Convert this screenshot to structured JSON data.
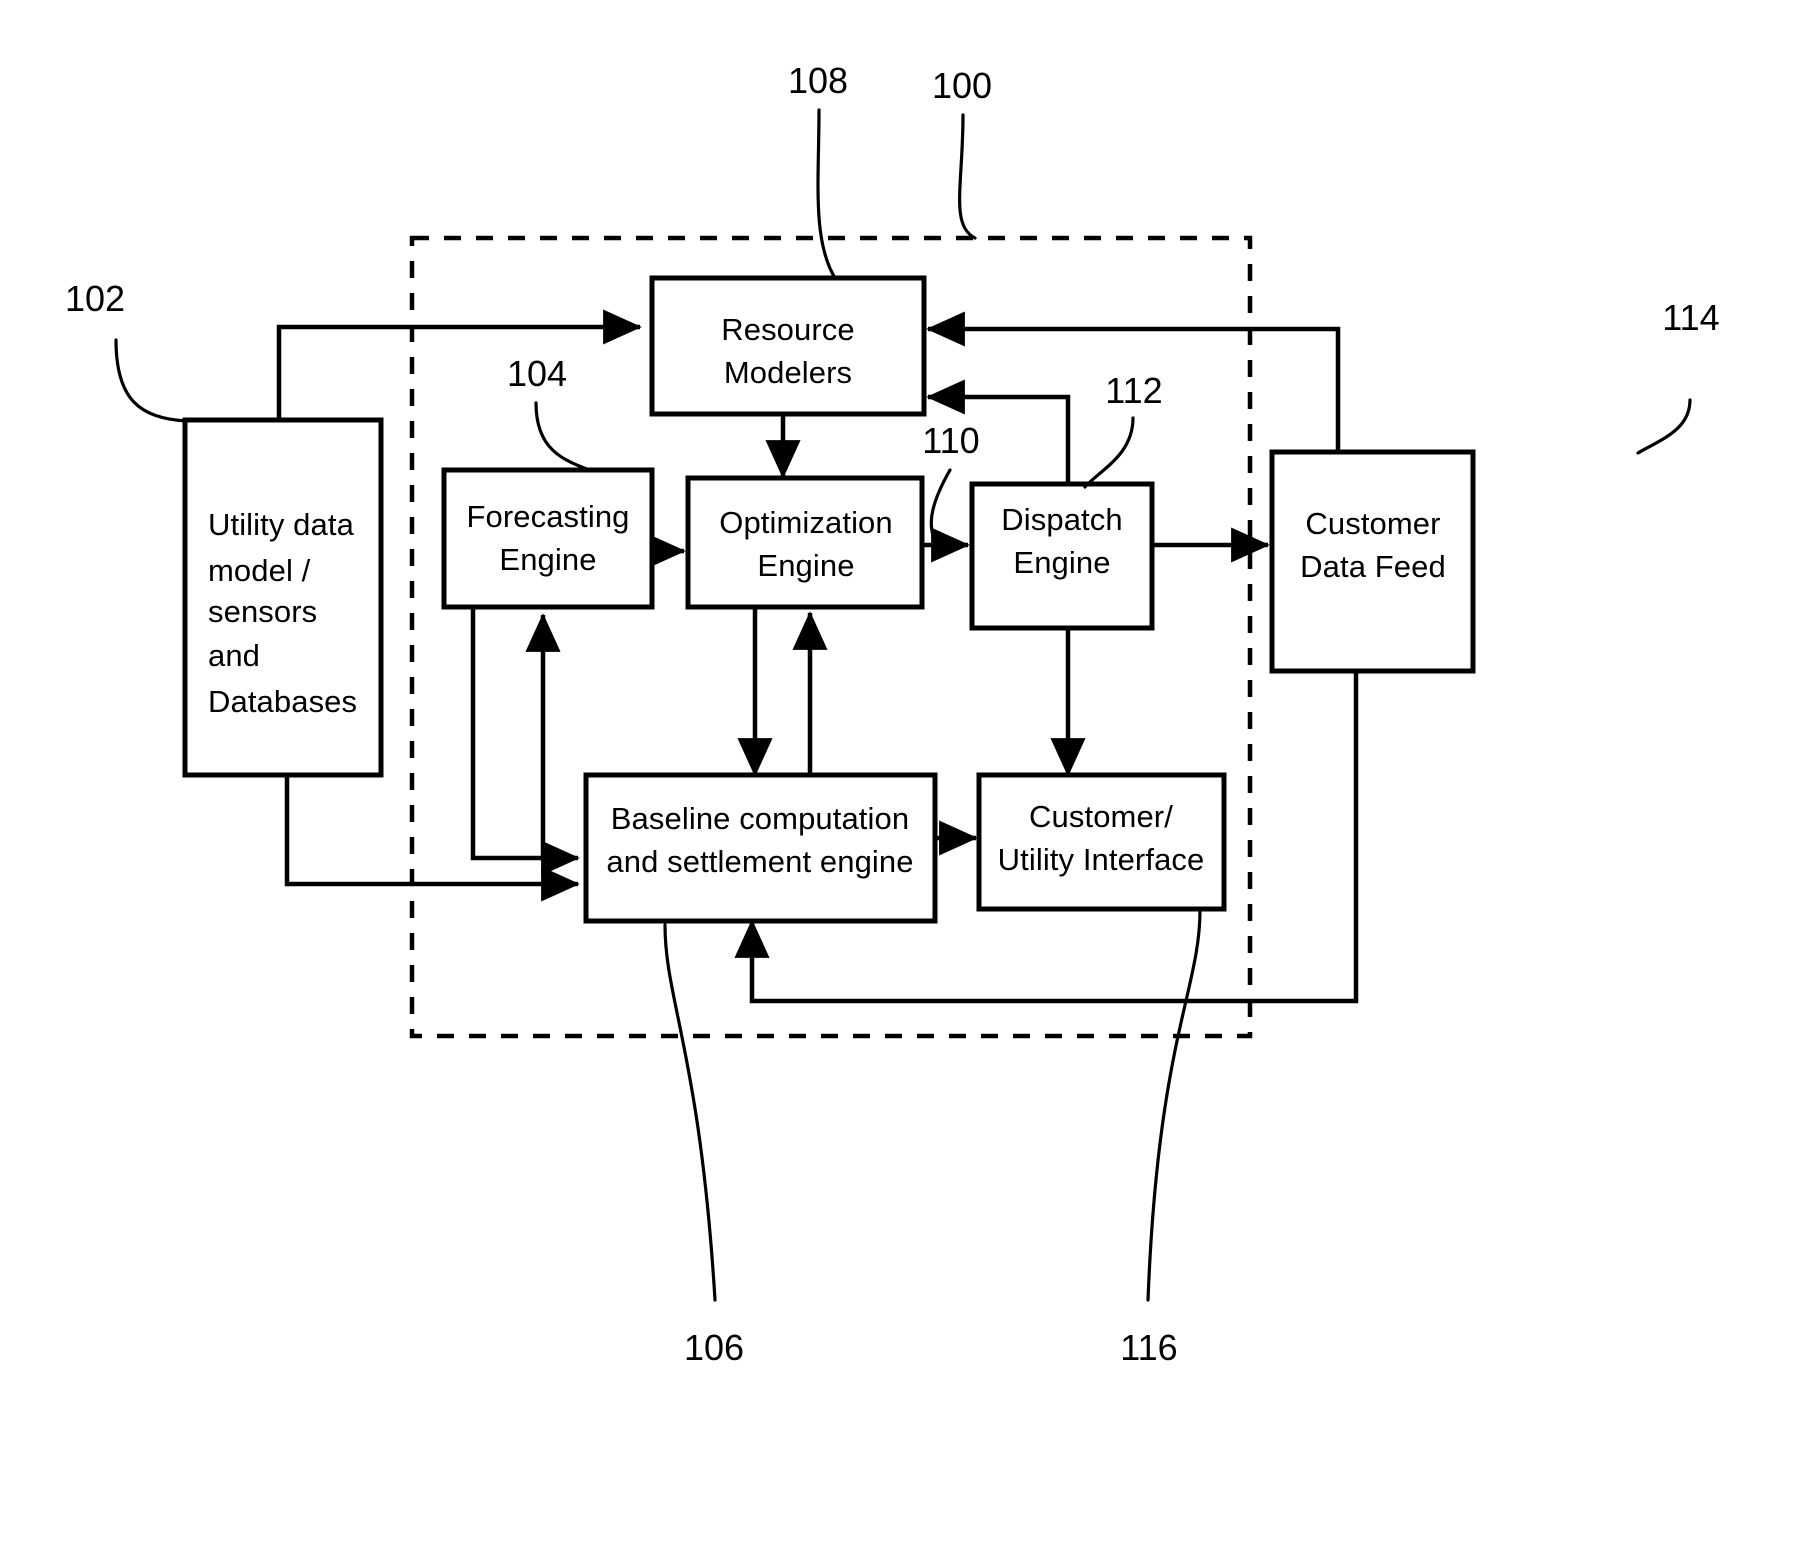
{
  "figure": {
    "type": "patent-block-diagram",
    "background_color": "#ffffff",
    "line_color": "#000000"
  },
  "boundary": {
    "label": "system-boundary",
    "style": "dashed",
    "ref": "100"
  },
  "boxes": [
    {
      "id": "utility-data-model",
      "ref": "102",
      "lines": [
        "Utility data",
        "model /",
        "sensors",
        "and",
        "Databases"
      ],
      "align": "left"
    },
    {
      "id": "resource-modelers",
      "ref": "108",
      "lines": [
        "Resource",
        "Modelers"
      ],
      "align": "center"
    },
    {
      "id": "forecasting-engine",
      "ref": "104",
      "lines": [
        "Forecasting",
        "Engine"
      ],
      "align": "center"
    },
    {
      "id": "optimization-engine",
      "ref": "110",
      "lines": [
        "Optimization",
        "Engine"
      ],
      "align": "center"
    },
    {
      "id": "dispatch-engine",
      "ref": "112",
      "lines": [
        "Dispatch",
        "Engine"
      ],
      "align": "center"
    },
    {
      "id": "customer-data-feed",
      "ref": "114",
      "lines": [
        "Customer",
        "Data Feed"
      ],
      "align": "center"
    },
    {
      "id": "baseline-settlement-engine",
      "ref": "106",
      "lines": [
        "Baseline computation",
        "and settlement engine"
      ],
      "align": "center"
    },
    {
      "id": "customer-utility-interface",
      "ref": "116",
      "lines": [
        "Customer/",
        "Utility Interface"
      ],
      "align": "center"
    }
  ],
  "reference_numerals": [
    {
      "value": "108",
      "target": "resource-modelers"
    },
    {
      "value": "100",
      "target": "system-boundary"
    },
    {
      "value": "102",
      "target": "utility-data-model"
    },
    {
      "value": "104",
      "target": "forecasting-engine"
    },
    {
      "value": "110",
      "target": "optimization-engine"
    },
    {
      "value": "112",
      "target": "dispatch-engine"
    },
    {
      "value": "114",
      "target": "customer-data-feed"
    },
    {
      "value": "106",
      "target": "baseline-settlement-engine"
    },
    {
      "value": "116",
      "target": "customer-utility-interface"
    }
  ],
  "connections": [
    {
      "from": "utility-data-model",
      "to": "resource-modelers",
      "arrow": true
    },
    {
      "from": "utility-data-model",
      "to": "baseline-settlement-engine",
      "arrow": true
    },
    {
      "from": "resource-modelers",
      "to": "optimization-engine",
      "arrow": true
    },
    {
      "from": "forecasting-engine",
      "to": "optimization-engine",
      "arrow": true
    },
    {
      "from": "optimization-engine",
      "to": "dispatch-engine",
      "arrow": true
    },
    {
      "from": "optimization-engine",
      "to": "baseline-settlement-engine",
      "arrow": true
    },
    {
      "from": "baseline-settlement-engine",
      "to": "optimization-engine",
      "arrow": true
    },
    {
      "from": "baseline-settlement-engine",
      "to": "forecasting-engine",
      "arrow": true
    },
    {
      "from": "baseline-settlement-engine",
      "to": "customer-utility-interface",
      "arrow": true
    },
    {
      "from": "dispatch-engine",
      "to": "customer-data-feed",
      "arrow": true
    },
    {
      "from": "dispatch-engine",
      "to": "baseline-settlement-engine",
      "arrow": false
    },
    {
      "from": "customer-data-feed",
      "to": "resource-modelers",
      "arrow": true
    },
    {
      "from": "customer-data-feed",
      "to": "baseline-settlement-engine",
      "arrow": true
    },
    {
      "from": "dispatch-engine",
      "to": "resource-modelers",
      "arrow": true
    }
  ]
}
